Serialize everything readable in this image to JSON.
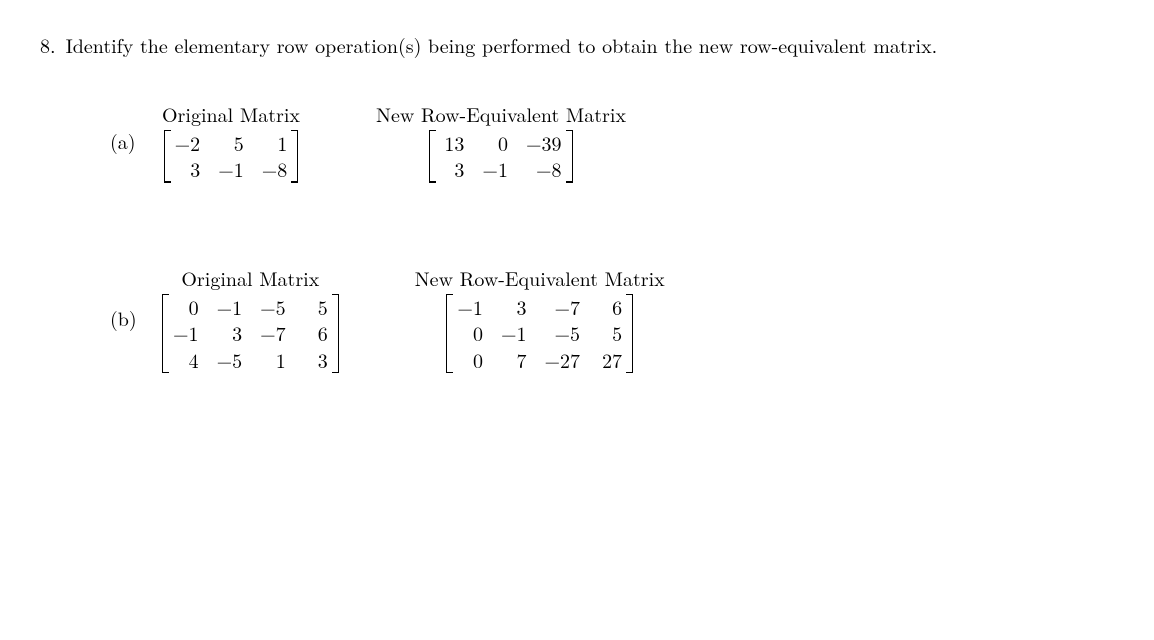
{
  "question": {
    "number": "8.",
    "text": "Identify the elementary row operation(s) being performed to obtain the new row-equivalent matrix."
  },
  "labels": {
    "original": "Original Matrix",
    "newrow": "New Row-Equivalent Matrix"
  },
  "parts": [
    {
      "label": "(a)",
      "original": {
        "rows": 2,
        "cols": 3,
        "data": [
          "−2",
          "5",
          "1",
          "3",
          "−1",
          "−8"
        ]
      },
      "result": {
        "rows": 2,
        "cols": 3,
        "data": [
          "13",
          "0",
          "−39",
          "3",
          "−1",
          "−8"
        ]
      }
    },
    {
      "label": "(b)",
      "original": {
        "rows": 3,
        "cols": 4,
        "data": [
          "0",
          "−1",
          "−5",
          "5",
          "−1",
          "3",
          "−7",
          "6",
          "4",
          "−5",
          "1",
          "3"
        ]
      },
      "result": {
        "rows": 3,
        "cols": 4,
        "data": [
          "−1",
          "3",
          "−7",
          "6",
          "0",
          "−1",
          "−5",
          "5",
          "0",
          "7",
          "−27",
          "27"
        ]
      }
    }
  ]
}
